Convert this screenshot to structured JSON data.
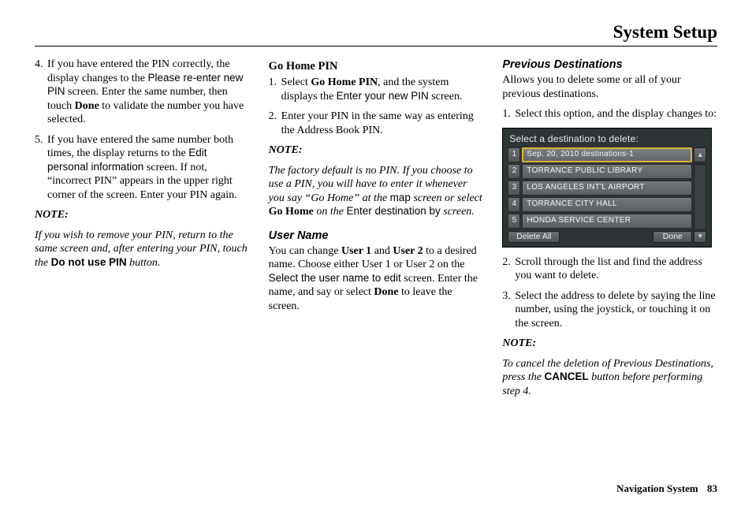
{
  "page_title": "System Setup",
  "col1": {
    "list": [
      {
        "n": "4.",
        "parts": [
          "If you have entered the PIN correctly, the display changes to the ",
          {
            "sans": "Please re-enter new PIN"
          },
          " screen. Enter the same number, then touch ",
          {
            "bold": "Done"
          },
          " to validate the number you have selected."
        ]
      },
      {
        "n": "5.",
        "parts": [
          "If you have entered the same number both times, the display returns to the ",
          {
            "sans": "Edit personal information"
          },
          " screen. If not, “incorrect PIN” appears in the upper right corner of the screen. Enter your PIN again."
        ]
      }
    ],
    "note_label": "NOTE:",
    "note_parts": [
      {
        "ital": "If you wish to remove your PIN, return to the same screen and, after entering your PIN, touch the "
      },
      {
        "sansbold": "Do not use PIN"
      },
      {
        "ital": " button."
      }
    ]
  },
  "col2": {
    "h1": "Go Home PIN",
    "list1": [
      {
        "n": "1.",
        "parts": [
          "Select ",
          {
            "bold": "Go Home PIN"
          },
          ", and the system displays the ",
          {
            "sans": "Enter your new PIN"
          },
          " screen."
        ]
      },
      {
        "n": "2.",
        "parts": [
          "Enter your PIN in the same way as entering the Address Book PIN."
        ]
      }
    ],
    "note_label": "NOTE:",
    "note_parts": [
      {
        "ital": "The factory default is no PIN. If you choose to use a PIN, you will have to enter it whenever you say “Go Home” at the "
      },
      {
        "sans": "map"
      },
      {
        "ital": " screen or select "
      },
      {
        "bold": "Go Home"
      },
      {
        "ital": " on the "
      },
      {
        "sans": "Enter destination by"
      },
      {
        "ital": " screen."
      }
    ],
    "h2": "User Name",
    "p2_parts": [
      "You can change ",
      {
        "bold": "User 1"
      },
      " and ",
      {
        "bold": "User 2"
      },
      " to a desired name. Choose either User 1 or User 2 on the ",
      {
        "sans": "Select the user name to edit"
      },
      " screen. Enter the name, and say or select ",
      {
        "bold": "Done"
      },
      " to leave the screen."
    ]
  },
  "col3": {
    "h1": "Previous Destinations",
    "intro": "Allows you to delete some or all of your previous destinations.",
    "list1": [
      {
        "n": "1.",
        "parts": [
          "Select this option, and the display changes to:"
        ]
      }
    ],
    "screen": {
      "header": "Select a destination to delete:",
      "rows": [
        {
          "n": "1",
          "label": "Sep. 20, 2010 destinations-1",
          "highlight": true
        },
        {
          "n": "2",
          "label": "TORRANCE PUBLIC LIBRARY"
        },
        {
          "n": "3",
          "label": "LOS ANGELES INT'L AIRPORT"
        },
        {
          "n": "4",
          "label": "TORRANCE CITY HALL"
        },
        {
          "n": "5",
          "label": "HONDA SERVICE CENTER"
        }
      ],
      "delete_all": "Delete All",
      "done": "Done"
    },
    "list2": [
      {
        "n": "2.",
        "parts": [
          "Scroll through the list and find the address you want to delete."
        ]
      },
      {
        "n": "3.",
        "parts": [
          "Select the address to delete by saying the line number, using the joystick, or touching it on the screen."
        ]
      }
    ],
    "note_label": "NOTE:",
    "note_parts": [
      {
        "ital": "To cancel the deletion of Previous Destinations, press the "
      },
      {
        "sansbold": "CANCEL"
      },
      {
        "ital": " button before performing step 4."
      }
    ]
  },
  "footer": {
    "label": "Navigation System",
    "page": "83"
  }
}
